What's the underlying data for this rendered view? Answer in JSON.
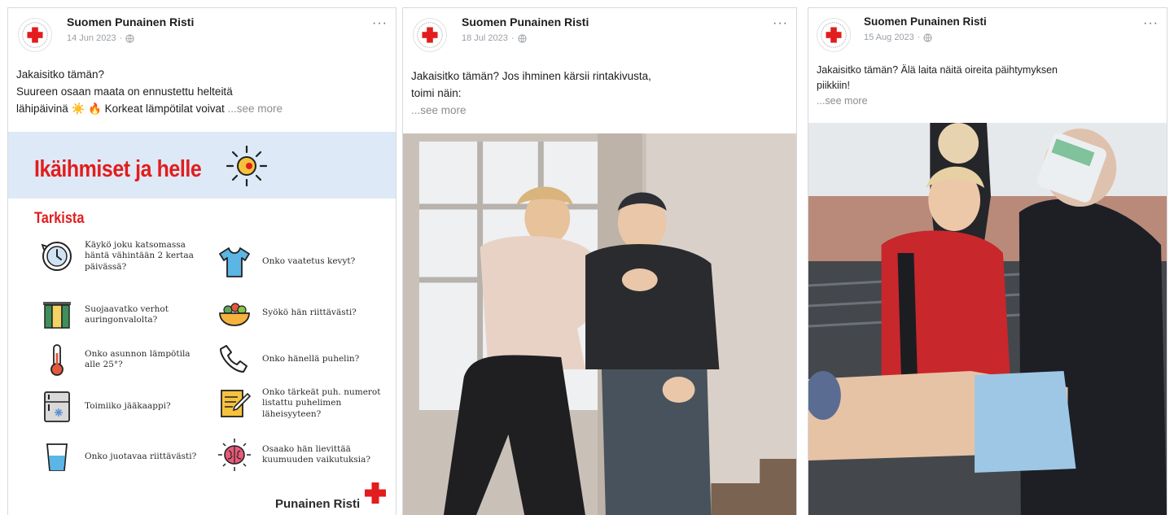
{
  "posts": [
    {
      "page_name": "Suomen Punainen Risti",
      "date": "14 Jun 2023",
      "caption_lines": [
        "Jakaisitko tämän?",
        "Suureen osaan maata on ennustettu helteitä",
        "lähipäivinä ☀️ 🔥 Korkeat lämpötilat voivat"
      ],
      "see_more": "...see more",
      "infographic": {
        "title": "Ikäihmiset ja helle",
        "subtitle": "Tarkista",
        "items": [
          {
            "icon": "clock-icon",
            "text": "Käykö joku katsomassa häntä vähintään 2 kertaa päivässä?"
          },
          {
            "icon": "tshirt-icon",
            "text": "Onko vaatetus kevyt?"
          },
          {
            "icon": "curtain-icon",
            "text": "Suojaavatko verhot auringonvalolta?"
          },
          {
            "icon": "food-bowl-icon",
            "text": "Syökö hän riittävästi?"
          },
          {
            "icon": "thermometer-icon",
            "text": "Onko asunnon lämpötila alle 25°?"
          },
          {
            "icon": "phone-icon",
            "text": "Onko hänellä puhelin?"
          },
          {
            "icon": "fridge-icon",
            "text": "Toimiiko jääkaappi?"
          },
          {
            "icon": "notepad-icon",
            "text": "Onko tärkeät puh. numerot listattu puhelimen läheisyyteen?"
          },
          {
            "icon": "water-glass-icon",
            "text": "Onko juotavaa riittävästi?"
          },
          {
            "icon": "brain-icon",
            "text": "Osaako hän lievittää kuumuuden vaikutuksia?"
          }
        ],
        "brand": "Punainen Risti"
      }
    },
    {
      "page_name": "Suomen Punainen Risti",
      "date": "18 Jul 2023",
      "caption_lines": [
        "Jakaisitko tämän? Jos ihminen kärsii rintakivusta,",
        "toimi näin:"
      ],
      "see_more": "...see more"
    },
    {
      "page_name": "Suomen Punainen Risti",
      "date": "15 Aug 2023",
      "caption_lines": [
        "Jakaisitko tämän? Älä laita näitä oireita päihtymyksen",
        "piikkiin!"
      ],
      "see_more": "...see more"
    }
  ],
  "colors": {
    "brand_red": "#e21d1d",
    "banner_blue": "#dde9f6",
    "muted_text": "#8a8d91"
  },
  "icons": {
    "avatar": "red-cross-logo",
    "visibility": "globe-icon",
    "menu": "more-horizontal-icon"
  }
}
